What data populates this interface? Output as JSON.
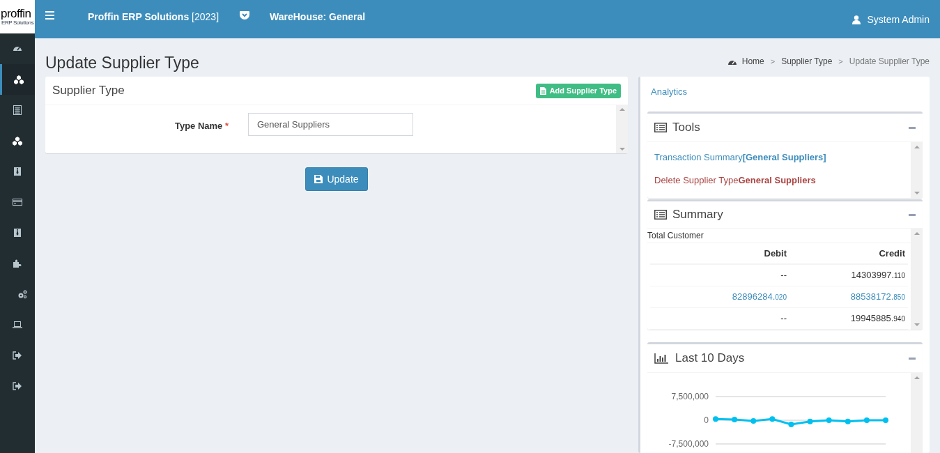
{
  "logo": {
    "text": "proffin",
    "subtext": "ERP Solutions"
  },
  "header": {
    "title": "**Proffin ERP Solutions** [2023]",
    "warehouse": "WareHouse: General",
    "user": "System Admin"
  },
  "sidebar": {
    "items": [
      {
        "kind": "dashboard",
        "selected": false
      },
      {
        "kind": "cubes",
        "selected": true
      },
      {
        "kind": "calculator",
        "selected": false
      },
      {
        "kind": "cubes",
        "selected": false
      },
      {
        "kind": "tie",
        "selected": false
      },
      {
        "kind": "card",
        "selected": false
      },
      {
        "kind": "tie",
        "selected": false
      },
      {
        "kind": "puzzle",
        "selected": false
      },
      {
        "kind": "gears",
        "selected": false
      },
      {
        "kind": "laptop",
        "selected": false
      },
      {
        "kind": "signout",
        "selected": false
      },
      {
        "kind": "signout",
        "selected": false
      }
    ]
  },
  "page_title": "Update Supplier Type",
  "breadcrumb": {
    "separator": ">",
    "items": [
      "Home",
      "Supplier Type",
      "Update Supplier Type"
    ]
  },
  "form": {
    "title": "Supplier Type",
    "add_button": "Add Supplier Type",
    "label": "Type Name",
    "required_mark": "*",
    "value": "General Suppliers",
    "submit": "Update"
  },
  "analytics": {
    "title": "Analytics",
    "tools": {
      "title": "Tools",
      "links": [
        {
          "kind": "info",
          "text": "Transaction Summary**[General Suppliers]**"
        },
        {
          "kind": "danger",
          "text": "Delete Supplier Type**General Suppliers**"
        }
      ]
    },
    "summary": {
      "title": "Summary",
      "caption": "Total Customer",
      "columns": [
        "Debit",
        "Credit"
      ],
      "rows": [
        [
          {
            "whole": "--",
            "link": false
          },
          {
            "whole": "14303997.",
            "fraction": "110",
            "link": false
          }
        ],
        [
          {
            "whole": "82896284.",
            "fraction": "020",
            "link": true
          },
          {
            "whole": "88538172.",
            "fraction": "850",
            "link": true
          }
        ],
        [
          {
            "whole": "--",
            "link": false
          },
          {
            "whole": "19945885.",
            "fraction": "940",
            "link": false
          }
        ]
      ]
    },
    "last_days": {
      "title": "Last 10 Days",
      "chart_data": {
        "type": "line",
        "series": [
          {
            "color": "#00c0ef",
            "marker": "circle",
            "values": [
              400000,
              200000,
              -200000,
              400000,
              -1300000,
              -400000,
              0,
              -400000,
              0,
              0
            ]
          }
        ],
        "ylim": [
          -7500000,
          7500000
        ],
        "yticks": [
          {
            "value": 7500000,
            "label": "7,500,000"
          },
          {
            "value": 0,
            "label": "0"
          },
          {
            "value": -7500000,
            "label": "-7,500,000"
          }
        ]
      }
    }
  }
}
